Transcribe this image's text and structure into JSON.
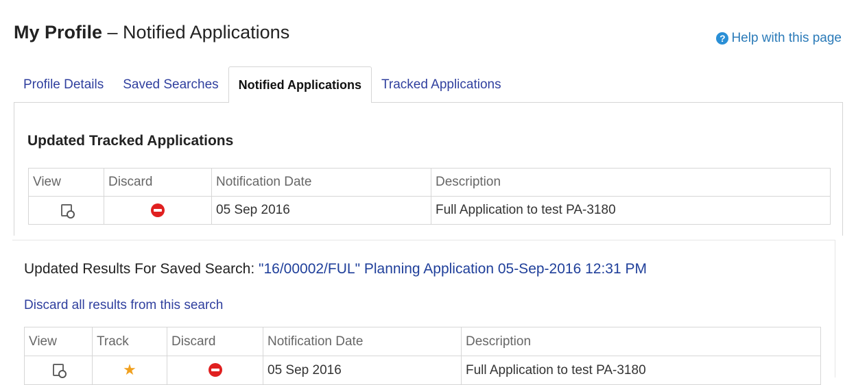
{
  "header": {
    "title_strong": "My Profile",
    "title_rest": " – Notified Applications",
    "help_label": "Help with this page",
    "help_icon": "help-icon"
  },
  "tabs": [
    {
      "label": "Profile Details",
      "active": false
    },
    {
      "label": "Saved Searches",
      "active": false
    },
    {
      "label": "Notified Applications",
      "active": true
    },
    {
      "label": "Tracked Applications",
      "active": false
    }
  ],
  "tracked": {
    "title": "Updated Tracked Applications",
    "columns": [
      "View",
      "Discard",
      "Notification Date",
      "Description"
    ],
    "rows": [
      {
        "view_icon": "view-document-icon",
        "discard_icon": "discard-icon",
        "date": "05 Sep 2016",
        "description": "Full Application to test PA-3180"
      }
    ]
  },
  "saved_search": {
    "title_prefix": "Updated Results For Saved Search: ",
    "search_name": "\"16/00002/FUL\" Planning Application 05-Sep-2016 12:31 PM",
    "discard_all_label": "Discard all results from this search",
    "columns": [
      "View",
      "Track",
      "Discard",
      "Notification Date",
      "Description"
    ],
    "rows": [
      {
        "view_icon": "view-document-icon",
        "track_icon": "star-icon",
        "discard_icon": "discard-icon",
        "date": "05 Sep 2016",
        "description": "Full Application to test PA-3180"
      }
    ]
  },
  "colors": {
    "link": "#2f3f9e",
    "discard": "#e02020",
    "star": "#f0a01f",
    "help": "#2a8fd6"
  }
}
